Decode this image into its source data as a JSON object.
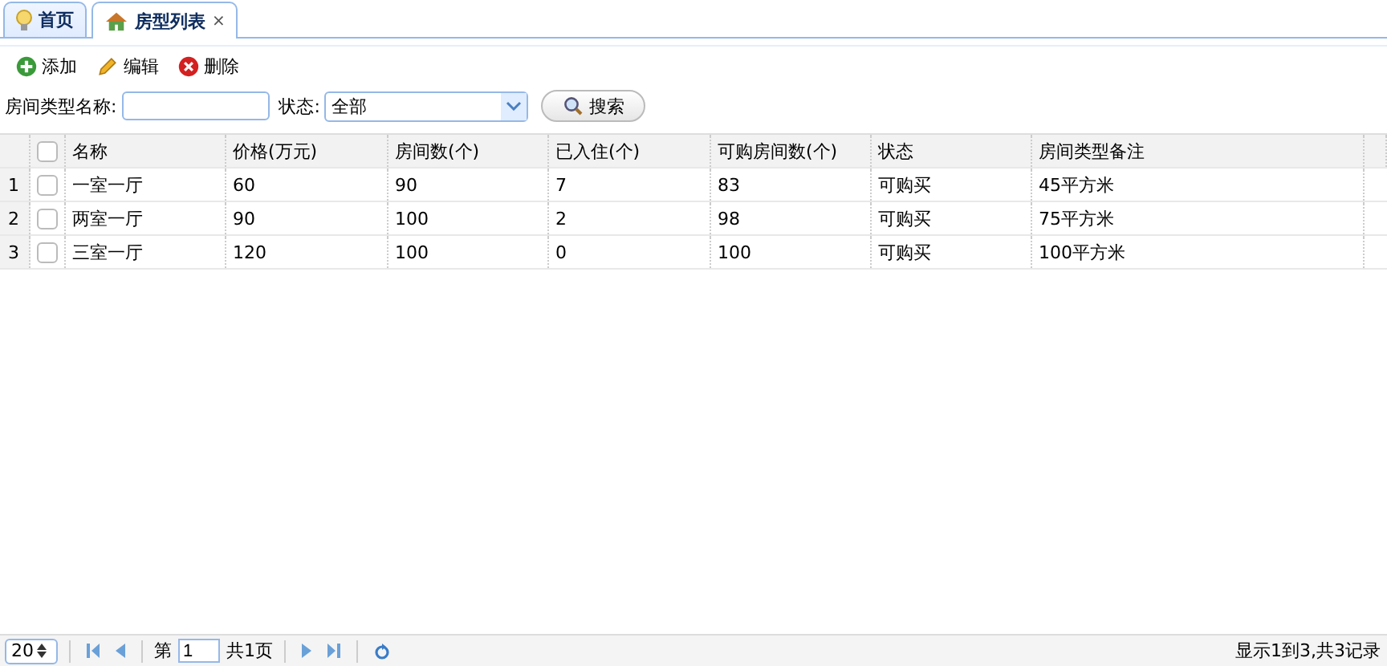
{
  "tabs": [
    {
      "label": "首页",
      "kind": "bulb",
      "selected": false
    },
    {
      "label": "房型列表",
      "kind": "house",
      "selected": true,
      "close": "×"
    }
  ],
  "toolbar": [
    {
      "label": "添加",
      "kind": "add"
    },
    {
      "label": "编辑",
      "kind": "edit"
    },
    {
      "label": "删除",
      "kind": "delete"
    }
  ],
  "search": {
    "name_label": "房间类型名称:",
    "status_label": "状态:",
    "status_value": "全部",
    "button": "搜索"
  },
  "table": {
    "select_all_checked": false,
    "columns": [
      "名称",
      "价格(万元)",
      "房间数(个)",
      "已入住(个)",
      "可购房间数(个)",
      "状态",
      "房间类型备注"
    ],
    "rows": [
      {
        "number": "1",
        "checked": false,
        "cells": [
          "一室一厅",
          "60",
          "90",
          "7",
          "83",
          "可购买",
          "45平方米"
        ]
      },
      {
        "number": "2",
        "checked": false,
        "cells": [
          "两室一厅",
          "90",
          "100",
          "2",
          "98",
          "可购买",
          "75平方米"
        ]
      },
      {
        "number": "3",
        "checked": false,
        "cells": [
          "三室一厅",
          "120",
          "100",
          "0",
          "100",
          "可购买",
          "100平方米"
        ]
      }
    ]
  },
  "pager": {
    "page_size": "20",
    "page_prefix": "第",
    "page": "1",
    "page_total": "共1页",
    "summary": "显示1到3,共3记录"
  }
}
